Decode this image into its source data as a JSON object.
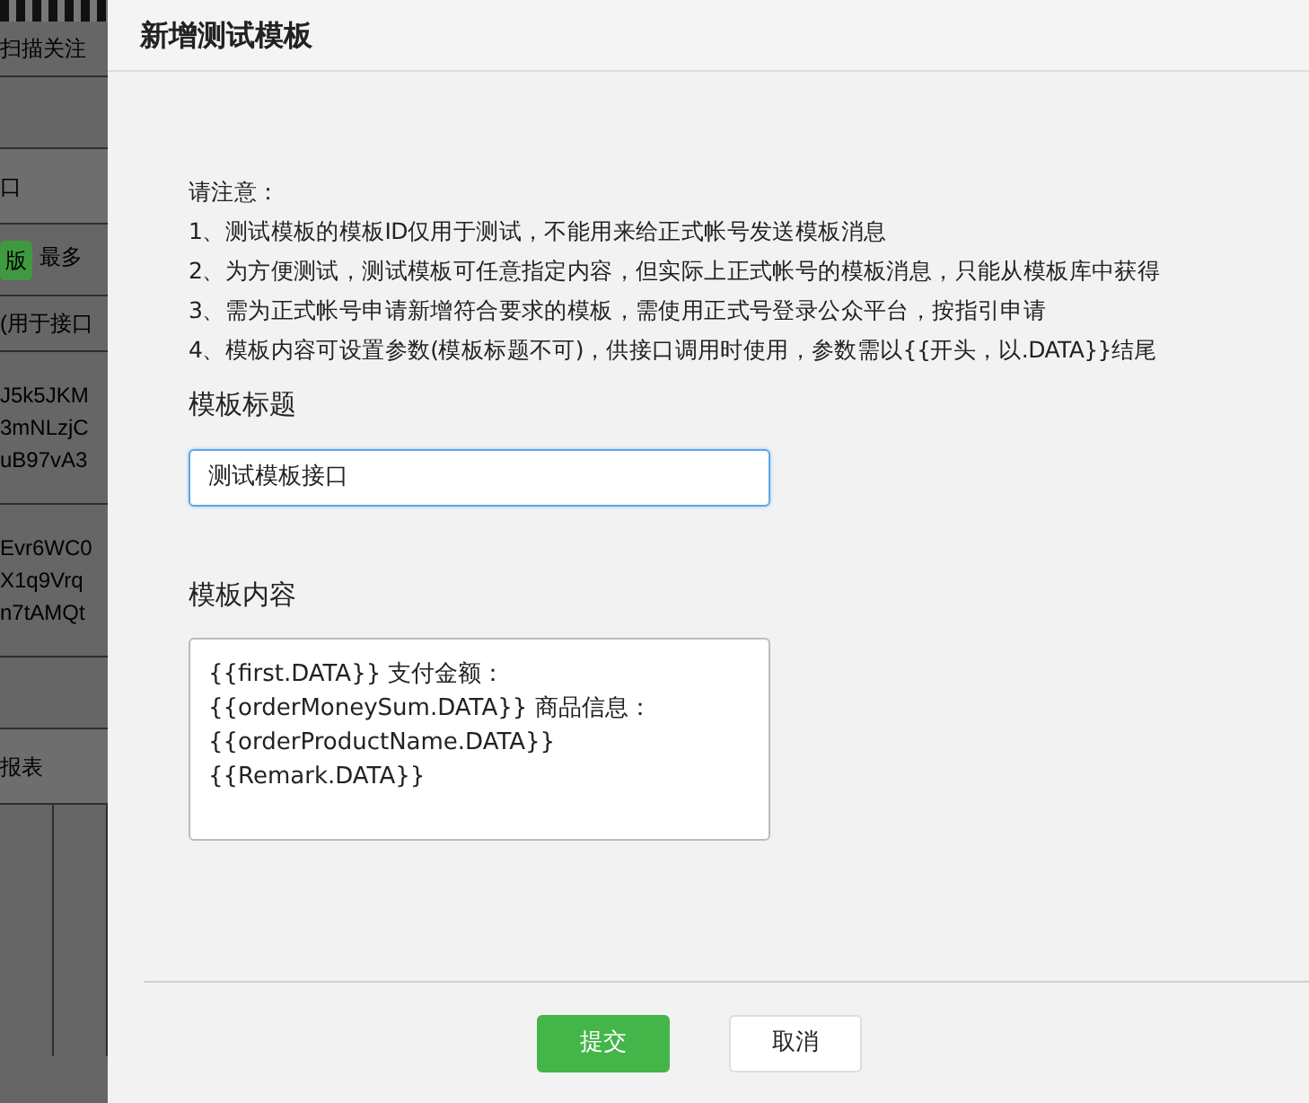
{
  "background_page": {
    "rows": [
      {
        "kind": "text",
        "lines": [
          "扫描关注"
        ]
      },
      {
        "kind": "blank",
        "lines": []
      },
      {
        "kind": "header",
        "lines": [
          "口"
        ]
      },
      {
        "kind": "badge",
        "badge": "版",
        "lines": [
          "最多"
        ]
      },
      {
        "kind": "text",
        "lines": [
          "(用于接口"
        ]
      },
      {
        "kind": "text",
        "lines": [
          "J5k5JKM",
          "3mNLzjC",
          "uB97vA3"
        ]
      },
      {
        "kind": "text",
        "lines": [
          "Evr6WC0",
          "X1q9Vrq",
          "n7tAMQt"
        ]
      },
      {
        "kind": "blank",
        "lines": []
      },
      {
        "kind": "header",
        "lines": [
          "报表"
        ]
      },
      {
        "kind": "grid",
        "lines": []
      }
    ]
  },
  "dialog": {
    "title": "新增测试模板",
    "notes": [
      "请注意：",
      "1、测试模板的模板ID仅用于测试，不能用来给正式帐号发送模板消息",
      "2、为方便测试，测试模板可任意指定内容，但实际上正式帐号的模板消息，只能从模板库中获得",
      "3、需为正式帐号申请新增符合要求的模板，需使用正式号登录公众平台，按指引申请",
      "4、模板内容可设置参数(模板标题不可)，供接口调用时使用，参数需以{{开头，以.DATA}}结尾"
    ],
    "title_field": {
      "label": "模板标题",
      "value": "测试模板接口"
    },
    "content_field": {
      "label": "模板内容",
      "lines": [
        "{{first.DATA}} 支付金额：",
        "{{orderMoneySum.DATA}} 商品信息：",
        "{{orderProductName.DATA}}",
        "{{Remark.DATA}}"
      ]
    },
    "buttons": [
      {
        "kind": "primary",
        "label": "提交"
      },
      {
        "kind": "default",
        "label": "取消"
      }
    ]
  }
}
